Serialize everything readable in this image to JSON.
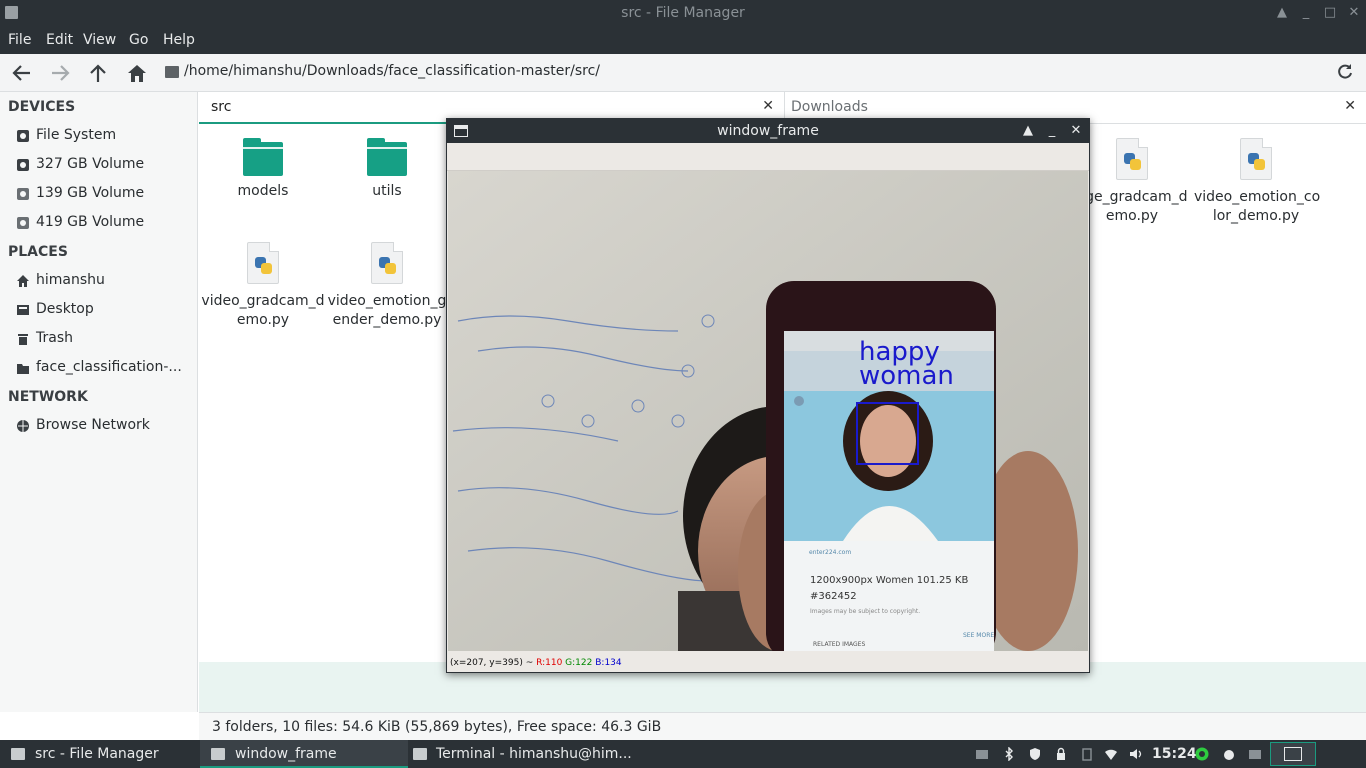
{
  "window": {
    "title": "src - File Manager",
    "controls": [
      "▲",
      "_",
      "□",
      "✕"
    ]
  },
  "menubar": [
    "File",
    "Edit",
    "View",
    "Go",
    "Help"
  ],
  "toolbar": {
    "path": "/home/himanshu/Downloads/face_classification-master/src/"
  },
  "sidebar": {
    "devices_header": "DEVICES",
    "devices": [
      "File System",
      "327 GB Volume",
      "139 GB Volume",
      "419 GB Volume"
    ],
    "places_header": "PLACES",
    "places": [
      "himanshu",
      "Desktop",
      "Trash",
      "face_classification-..."
    ],
    "network_header": "NETWORK",
    "network": [
      "Browse Network"
    ]
  },
  "left_pane": {
    "tab": "src",
    "close": "✕",
    "files": [
      {
        "line1": "models",
        "line2": ""
      },
      {
        "line1": "utils",
        "line2": ""
      },
      {
        "line1": "video_gradcam_d",
        "line2": "emo.py"
      },
      {
        "line1": "video_emotion_g",
        "line2": "ender_demo.py"
      }
    ]
  },
  "right_pane": {
    "tab": "Downloads",
    "close": "✕",
    "files": [
      {
        "line1": "age_gradcam_d",
        "line2": "emo.py"
      },
      {
        "line1": "video_emotion_co",
        "line2": "lor_demo.py"
      }
    ]
  },
  "status": "3 folders, 10 files: 54.6 KiB (55,869 bytes), Free space: 46.3 GiB",
  "popup": {
    "title": "window_frame",
    "controls": [
      "▲",
      "_",
      "✕"
    ],
    "overlay_line1": "happy",
    "overlay_line2": "woman",
    "phone_text_size": "1200x900px Women 101.25 KB",
    "phone_text_id": "#362452",
    "phone_text_small": "Images may be subject to copyright.",
    "phone_related": "RELATED IMAGES",
    "phone_see_more": "SEE MORE",
    "phone_site": "enter224.com",
    "pixel_coords": "(x=207, y=395) ~ ",
    "pixel_r": "R:110",
    "pixel_g": "G:122",
    "pixel_b": "B:134",
    "colors": {
      "r": "#e00000",
      "g": "#008800",
      "b": "#0000cc",
      "box": "#1a1acc"
    }
  },
  "taskbar": {
    "tasks": [
      "src - File Manager",
      "window_frame",
      "Terminal - himanshu@him..."
    ],
    "clock": "15:24"
  },
  "colors": {
    "accent": "#1b9b80",
    "dark": "#2b3136",
    "folder": "#16a085"
  }
}
